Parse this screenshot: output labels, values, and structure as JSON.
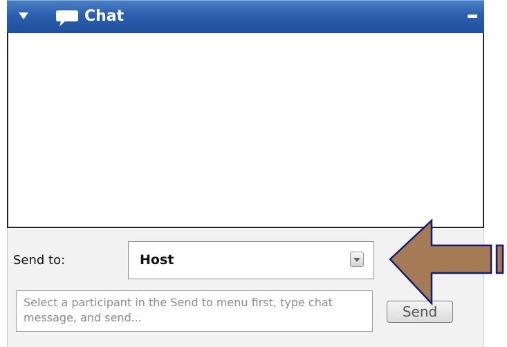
{
  "panel": {
    "title": "Chat",
    "icons": {
      "collapse": "triangle-down-icon",
      "chat": "speech-bubble-icon",
      "minimize": "minimize-icon"
    }
  },
  "chat_area": {
    "messages": []
  },
  "send_to": {
    "label": "Send to:",
    "selected_value": "Host"
  },
  "message": {
    "value": "",
    "placeholder": "Select a participant in the Send to menu first, type chat message, and send..."
  },
  "send_button": {
    "label": "Send"
  },
  "colors": {
    "titlebar": "#2b5fae",
    "arrow_fill": "#a57b55",
    "arrow_outline": "#1a1a6e"
  }
}
